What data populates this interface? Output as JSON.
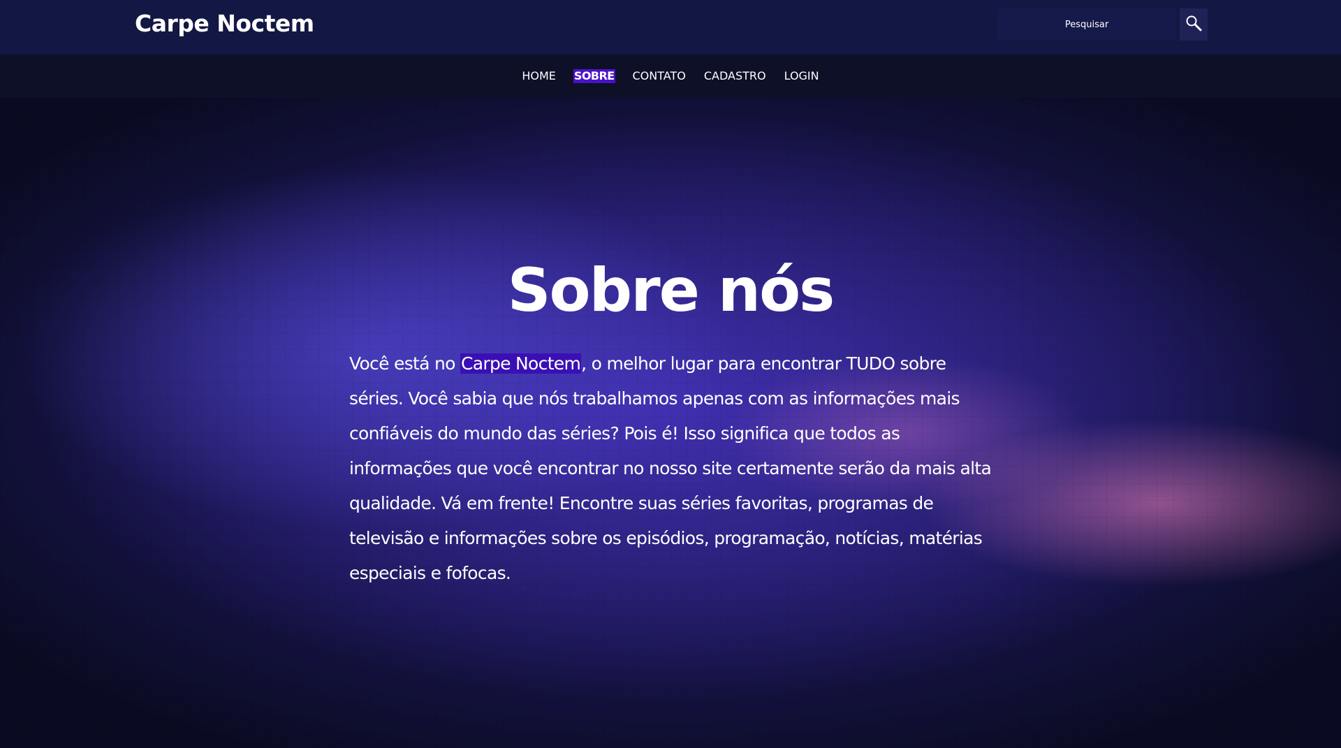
{
  "header": {
    "logo": "Carpe Noctem",
    "search": {
      "placeholder": "Pesquisar",
      "icon": "search-icon"
    }
  },
  "nav": {
    "items": [
      {
        "label": "HOME",
        "active": false
      },
      {
        "label": "SOBRE",
        "active": true
      },
      {
        "label": "CONTATO",
        "active": false
      },
      {
        "label": "CADASTRO",
        "active": false
      },
      {
        "label": "LOGIN",
        "active": false
      }
    ]
  },
  "main": {
    "title": "Sobre nós",
    "paragraph_start": "Você está no ",
    "paragraph_highlight": "Carpe Noctem",
    "paragraph_rest": ", o melhor lugar para encontrar TUDO sobre séries. Você sabia que nós trabalhamos apenas com as informações mais confiáveis do mundo das séries? Pois é! Isso significa que todos as informações que você encontrar no nosso site certamente serão da mais alta qualidade. Vá em frente! Encontre suas séries favoritas, programas de televisão e informações sobre os episódios, programação, notícias, matérias especiais e fofocas."
  },
  "colors": {
    "header_bg": "#131743",
    "nav_bg": "#0e1028",
    "active_highlight": "#4a12c8",
    "text_highlight": "#3a10b4"
  }
}
